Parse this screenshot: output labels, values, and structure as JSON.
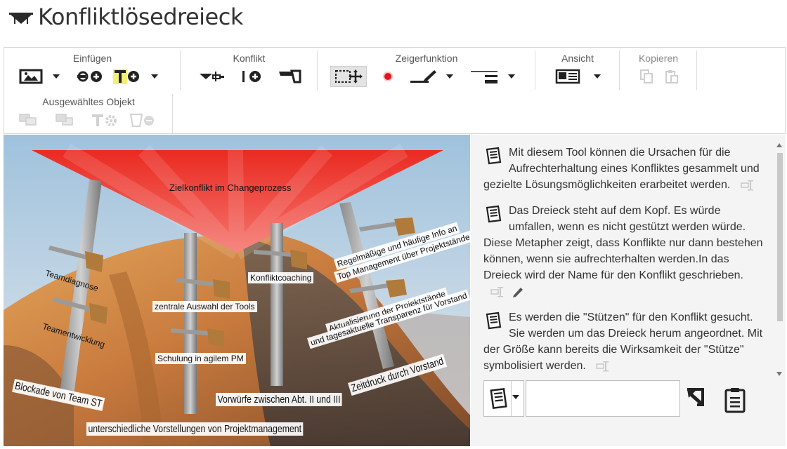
{
  "app": {
    "title": "Konfliktlösedreieck",
    "logo_icon": "dark-triangle-icon"
  },
  "ribbon": {
    "groups": [
      {
        "label": "Einfügen",
        "buttons": [
          "insert-image-icon",
          "insert-support-icon",
          "insert-text-icon"
        ]
      },
      {
        "label": "Konflikt",
        "buttons": [
          "conflict-arrow-icon",
          "add-support-icon",
          "saw-icon"
        ]
      },
      {
        "label": "Zeigerfunktion",
        "buttons": [
          "select-move-icon",
          "red-dot-icon",
          "pen-icon",
          "line-width-icon"
        ]
      },
      {
        "label": "Ansicht",
        "buttons": [
          "view-card-icon"
        ]
      },
      {
        "label": "Kopieren",
        "buttons": [
          "copy-icon",
          "paste-icon"
        ]
      },
      {
        "label": "Ausgewähltes Objekt",
        "buttons": [
          "bring-front-icon",
          "send-back-icon",
          "text-settings-icon",
          "delete-icon"
        ]
      }
    ]
  },
  "canvas": {
    "triangle_label": "Zielkonflikt im Changeprozess",
    "triangle_color": "#e8201c",
    "saw_labels": [
      "Teamdiagnose",
      "Teamentwicklung",
      "zentrale Auswahl der Tools",
      "Schulung in agilem PM",
      "Konfliktcoaching",
      "Regelmäßige und häufige Info an",
      "Top Management über Projektstände",
      "Aktualisierung der Projektstände",
      "und tagesaktuelle Transparenz für Vorstand"
    ],
    "support_labels": [
      "Blockade von Team ST",
      "unterschiedliche Vorstellungen von Projektmanagement",
      "Vorwürfe zwischen Abt. II und III",
      "Zeitdruck durch Vorstand"
    ]
  },
  "info": {
    "paragraphs": [
      "Mit diesem Tool können die Ursachen für die Aufrechterhaltung eines Konfliktes gesammelt und gezielte Lösungsmöglichkeiten erarbeitet werden.",
      "Das Dreieck steht auf dem Kopf. Es würde umfallen, wenn es nicht gestützt werden würde. Diese Metapher zeigt, dass Konflikte nur dann bestehen können, wenn sie aufrechterhalten werden.In das Dreieck wird der Name für den Konflikt geschrieben.",
      "Es werden die \"Stützen\" für den Konflikt gesucht. Sie werden um das Dreieck herum angeordnet. Mit der Größe kann bereits die Wirksamkeit der \"Stütze\" symbolisiert werden."
    ],
    "new_text_value": "",
    "accent_color": "#333333"
  }
}
